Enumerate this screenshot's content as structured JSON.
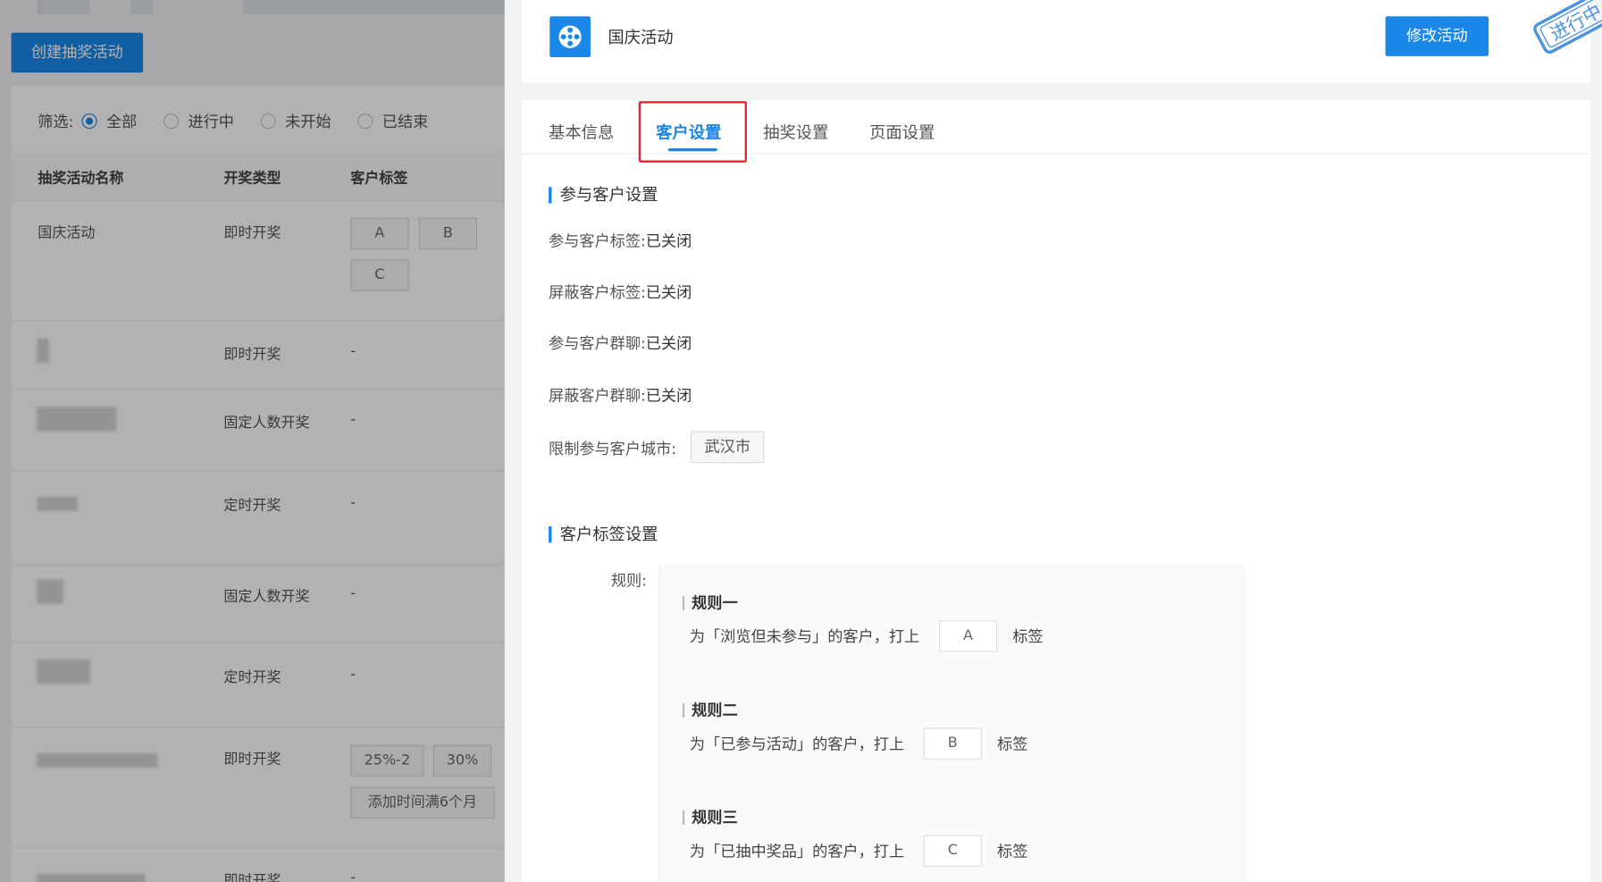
{
  "list_page": {
    "create_button": "创建抽奖活动",
    "filter": {
      "label": "筛选:",
      "options": [
        "全部",
        "进行中",
        "未开始",
        "已结束"
      ],
      "selected_index": 0
    },
    "columns": [
      "抽奖活动名称",
      "开奖类型",
      "客户标签"
    ],
    "rows": [
      {
        "name": "国庆活动",
        "type": "即时开奖",
        "tags": [
          "A",
          "B",
          "C"
        ]
      },
      {
        "name": "",
        "type": "即时开奖",
        "tags_text": "-"
      },
      {
        "name": "",
        "type": "固定人数开奖",
        "tags_text": "-"
      },
      {
        "name": "",
        "type": "定时开奖",
        "tags_text": "-"
      },
      {
        "name": "",
        "type": "固定人数开奖",
        "tags_text": "-"
      },
      {
        "name": "",
        "type": "定时开奖",
        "tags_text": "-"
      },
      {
        "name": "",
        "type": "即时开奖",
        "tags": [
          "25%-2",
          "30%",
          "添加时间满6个月"
        ]
      },
      {
        "name": "",
        "type": "即时开奖",
        "tags_text": "-"
      }
    ]
  },
  "drawer": {
    "title": "国庆活动",
    "edit_button": "修改活动",
    "status_stamp": "进行中",
    "tabs": [
      "基本信息",
      "客户设置",
      "抽奖设置",
      "页面设置"
    ],
    "active_tab_index": 1,
    "participant_section": {
      "title": "参与客户设置",
      "items": [
        {
          "label": "参与客户标签:",
          "value": "已关闭"
        },
        {
          "label": "屏蔽客户标签:",
          "value": "已关闭"
        },
        {
          "label": "参与客户群聊:",
          "value": "已关闭"
        },
        {
          "label": "屏蔽客户群聊:",
          "value": "已关闭"
        }
      ],
      "city_label": "限制参与客户城市:",
      "city_value": "武汉市"
    },
    "tag_section": {
      "title": "客户标签设置",
      "rules_label": "规则:",
      "rules": [
        {
          "name": "规则一",
          "prefix": "为「浏览但未参与」的客户，打上",
          "tag": "A",
          "suffix": "标签"
        },
        {
          "name": "规则二",
          "prefix": "为「已参与活动」的客户，打上",
          "tag": "B",
          "suffix": "标签"
        },
        {
          "name": "规则三",
          "prefix": "为「已抽中奖品」的客户，打上",
          "tag": "C",
          "suffix": "标签"
        }
      ]
    }
  },
  "colors": {
    "primary": "#1b87e8",
    "highlight_border": "#e6212a"
  }
}
